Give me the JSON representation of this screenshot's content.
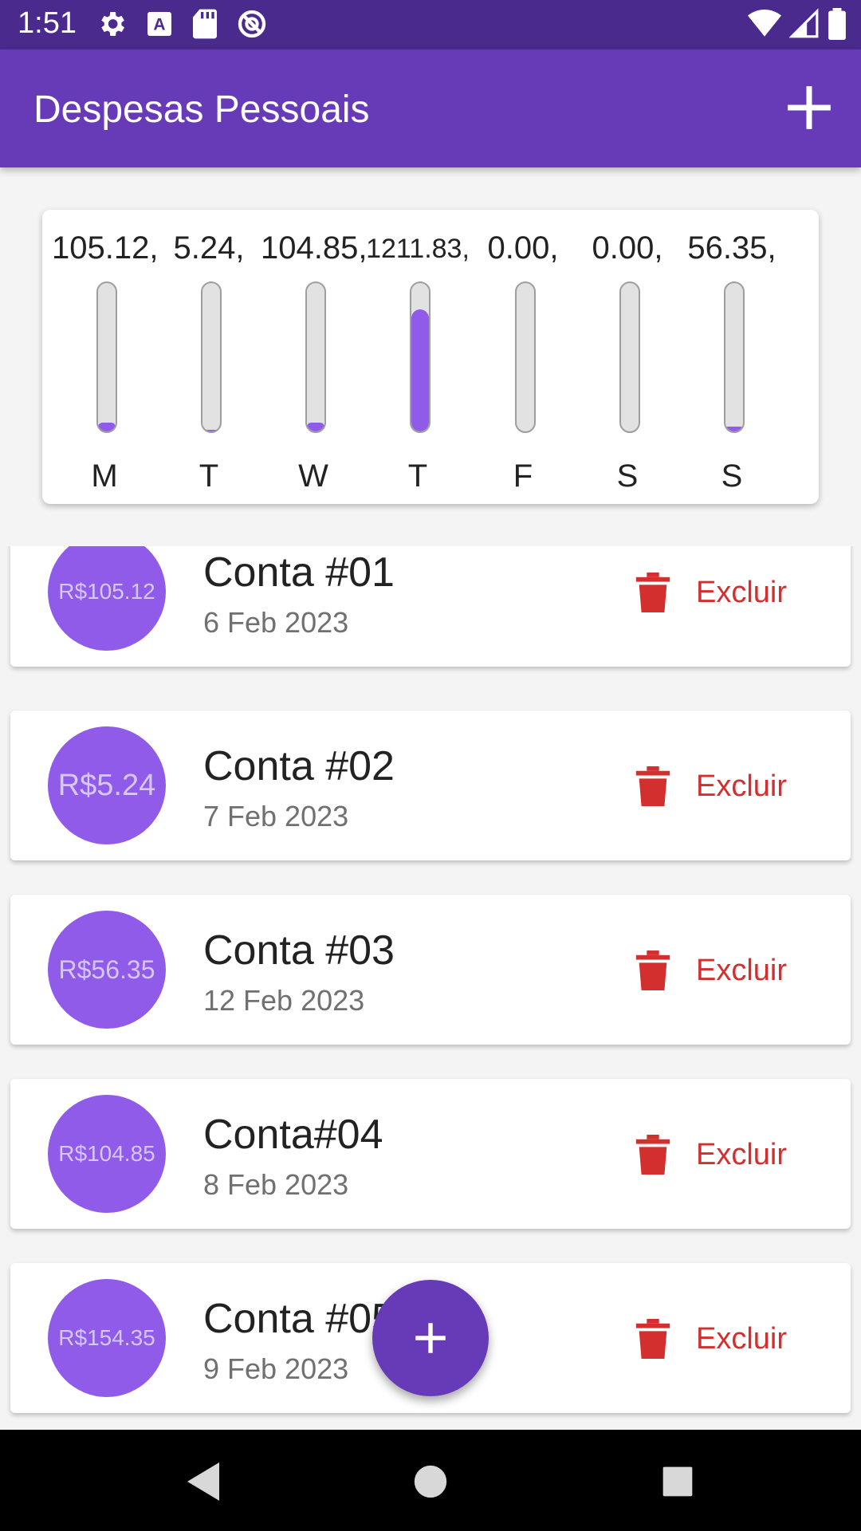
{
  "status_bar": {
    "time": "1:51"
  },
  "app_bar": {
    "title": "Despesas Pessoais"
  },
  "chart_data": {
    "type": "bar",
    "categories": [
      "M",
      "T",
      "W",
      "T",
      "F",
      "S",
      "S"
    ],
    "amount_labels": [
      "105.12,",
      "5.24,",
      "104.85,",
      "1211.83,",
      "0.00,",
      "0.00,",
      "56.35,"
    ],
    "values": [
      105.12,
      5.24,
      104.85,
      1211.83,
      0.0,
      0.0,
      56.35
    ],
    "fill_fraction": [
      0.06,
      0.01,
      0.06,
      0.82,
      0.0,
      0.0,
      0.03
    ],
    "bar_color": "#8f5be8"
  },
  "transactions": [
    {
      "amount": "R$105.12",
      "title": "Conta #01",
      "date": "6 Feb 2023",
      "delete_label": "Excluir"
    },
    {
      "amount": "R$5.24",
      "title": "Conta #02",
      "date": "7 Feb 2023",
      "delete_label": "Excluir"
    },
    {
      "amount": "R$56.35",
      "title": "Conta #03",
      "date": "12 Feb 2023",
      "delete_label": "Excluir"
    },
    {
      "amount": "R$104.85",
      "title": "Conta#04",
      "date": "8 Feb 2023",
      "delete_label": "Excluir"
    },
    {
      "amount": "R$154.35",
      "title": "Conta #05",
      "date": "9 Feb 2023",
      "delete_label": "Excluir"
    }
  ],
  "colors": {
    "primary": "#673ab7",
    "status_bar": "#4a2a8c",
    "accent": "#8f5be8",
    "danger": "#d32f2f"
  },
  "icons": {
    "add": "plus-icon",
    "delete": "trash-icon",
    "fab": "plus-icon",
    "nav_back": "back-triangle-icon",
    "nav_home": "home-circle-icon",
    "nav_recents": "recents-square-icon"
  }
}
